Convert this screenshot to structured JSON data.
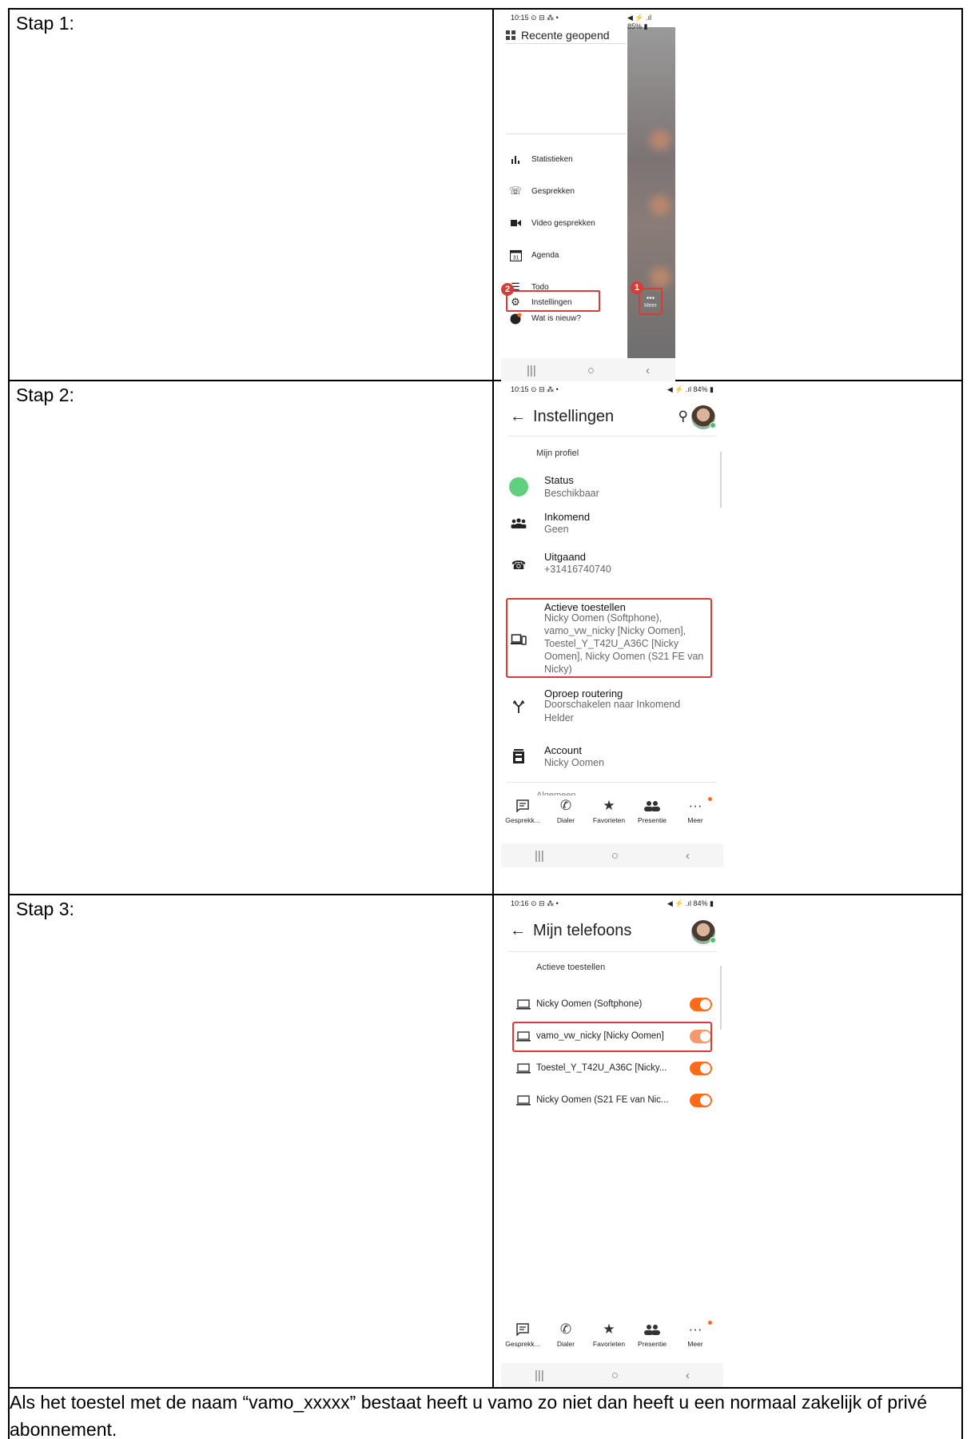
{
  "steps": [
    {
      "label": "Stap 1:"
    },
    {
      "label": "Stap 2:"
    },
    {
      "label": "Stap 3:"
    }
  ],
  "footer_text": "Als het toestel met de naam “vamo_xxxxx” bestaat heeft u vamo zo niet dan heeft u een normaal zakelijk of privé abonnement.",
  "colors": {
    "highlight": "#d93b3b",
    "accent": "#ff6a1a",
    "status_green": "#3fc56a"
  },
  "phone1": {
    "status_time": "10:15 ⊙ ⊟ ⁂ •",
    "status_sys": "◀ ⚡ .ıl 85% ▮",
    "recent_label": "Recente geopend",
    "menu": [
      {
        "icon": "bar-chart-icon",
        "label": "Statistieken"
      },
      {
        "icon": "phone-calls-icon",
        "label": "Gesprekken"
      },
      {
        "icon": "videocam-icon",
        "label": "Video gesprekken"
      },
      {
        "icon": "calendar-icon",
        "label": "Agenda"
      },
      {
        "icon": "list-icon",
        "label": "Todo"
      },
      {
        "icon": "new-icon",
        "label": "Wat is nieuw?"
      },
      {
        "icon": "gear-icon",
        "label": "Instellingen"
      }
    ],
    "meer_label": "Meer",
    "badge_1": "1",
    "badge_2": "2"
  },
  "phone2": {
    "status_time": "10:15 ⊙ ⊟ ⁂ •",
    "status_sys": "◀ ⚡ .ıl 84% ▮",
    "title": "Instellingen",
    "section": "Mijn profiel",
    "items": [
      {
        "icon": "status-dot-icon",
        "label": "Status",
        "value": "Beschikbaar"
      },
      {
        "icon": "group-icon",
        "label": "Inkomend",
        "value": "Geen"
      },
      {
        "icon": "outgoing-call-icon",
        "label": "Uitgaand",
        "value": "+31416740740"
      },
      {
        "icon": "devices-icon",
        "label": "Actieve toestellen",
        "value": "Nicky Oomen (Softphone), vamo_vw_nicky [Nicky Oomen], Toestel_Y_T42U_A36C [Nicky Oomen], Nicky Oomen (S21 FE van Nicky)"
      },
      {
        "icon": "routing-icon",
        "label": "Oproep routering",
        "value": "Doorschakelen naar Inkomend Helder"
      },
      {
        "icon": "account-icon",
        "label": "Account",
        "value": "Nicky Oomen"
      }
    ],
    "next_section": "Algemeen"
  },
  "bottom_nav": [
    {
      "icon": "chat-icon",
      "label": "Gesprekk..."
    },
    {
      "icon": "dialer-icon",
      "label": "Dialer"
    },
    {
      "icon": "star-icon",
      "label": "Favorieten"
    },
    {
      "icon": "presence-icon",
      "label": "Presentie"
    },
    {
      "icon": "more-icon",
      "label": "Meer"
    }
  ],
  "phone3": {
    "status_time": "10:16 ⊙ ⊟ ⁂ •",
    "status_sys": "◀ ⚡ .ıl 84% ▮",
    "title": "Mijn telefoons",
    "section": "Actieve toestellen",
    "devices": [
      {
        "name": "Nicky Oomen (Softphone)",
        "enabled": true
      },
      {
        "name": "vamo_vw_nicky [Nicky Oomen]",
        "enabled": true
      },
      {
        "name": "Toestel_Y_T42U_A36C [Nicky...",
        "enabled": true
      },
      {
        "name": "Nicky Oomen (S21 FE van Nic...",
        "enabled": true
      }
    ]
  },
  "android_nav": {
    "recents": "|||",
    "home": "○",
    "back": "‹"
  }
}
